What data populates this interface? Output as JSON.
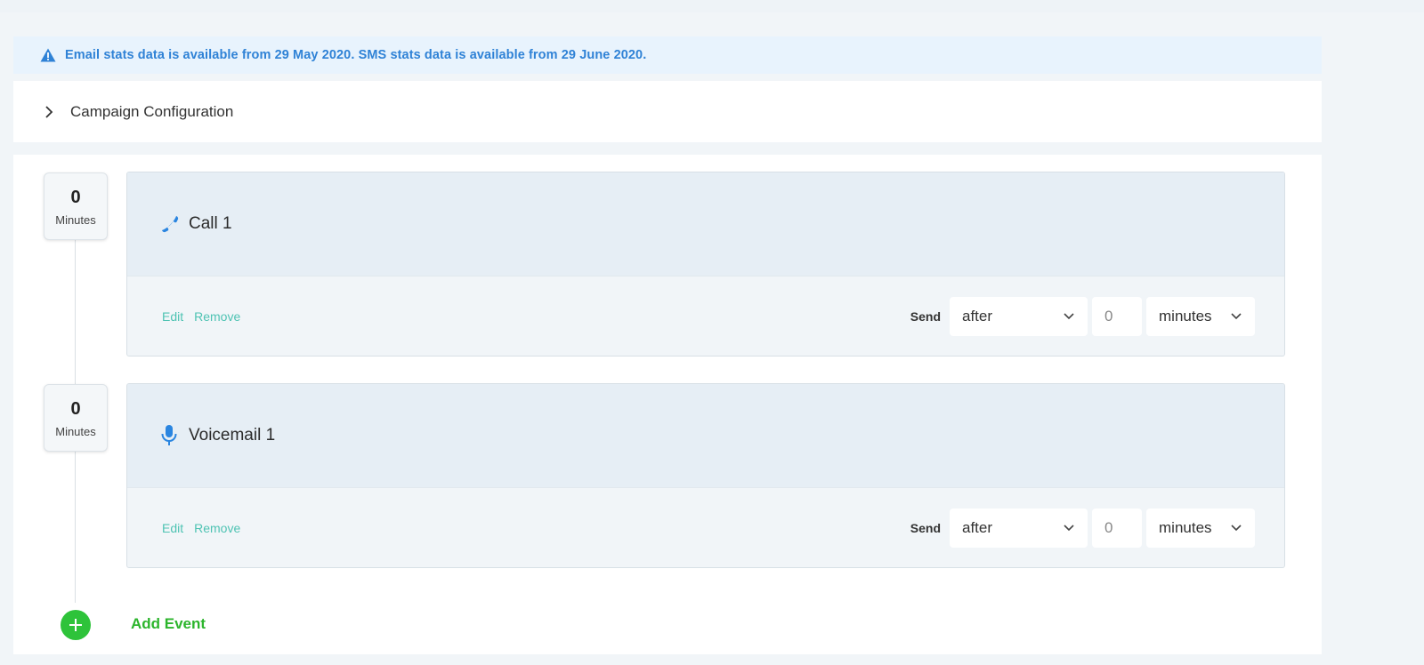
{
  "alert": {
    "icon": "warning-triangle-icon",
    "message": "Email stats data is available from 29 May 2020. SMS stats data is available from 29 June 2020."
  },
  "config": {
    "icon": "chevron-right-icon",
    "label": "Campaign Configuration"
  },
  "events": [
    {
      "delay_value": "0",
      "delay_unit": "Minutes",
      "icon": "phone-icon",
      "title": "Call 1",
      "edit_label": "Edit",
      "remove_label": "Remove",
      "send_label": "Send",
      "timing_value": "after",
      "amount_value": "0",
      "unit_value": "minutes"
    },
    {
      "delay_value": "0",
      "delay_unit": "Minutes",
      "icon": "microphone-icon",
      "title": "Voicemail 1",
      "edit_label": "Edit",
      "remove_label": "Remove",
      "send_label": "Send",
      "timing_value": "after",
      "amount_value": "0",
      "unit_value": "minutes"
    }
  ],
  "add_event": {
    "icon": "plus-icon",
    "label": "Add Event"
  },
  "colors": {
    "accent_blue": "#2f82d6",
    "link_teal": "#4fc3b3",
    "add_green": "#2ec33a"
  }
}
